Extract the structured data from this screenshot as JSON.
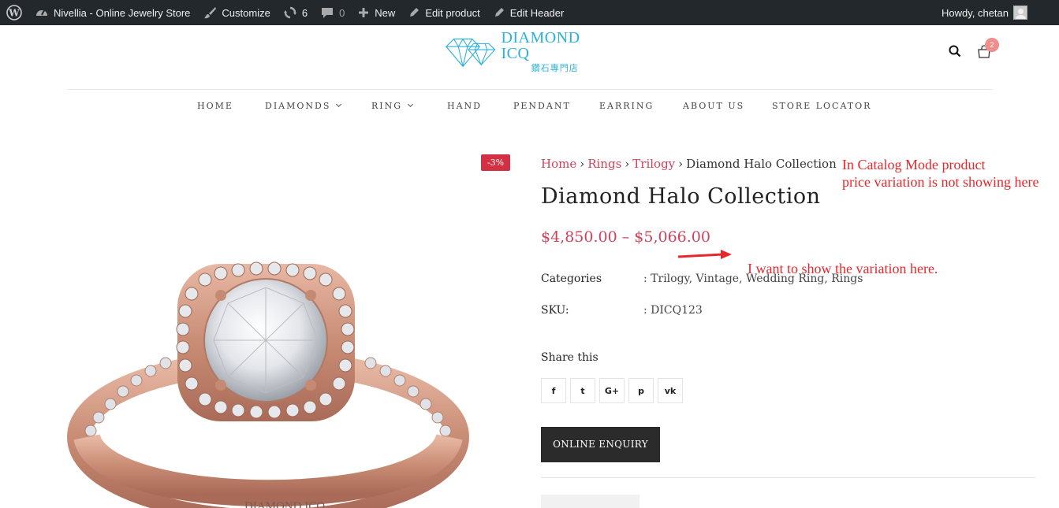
{
  "admin_bar": {
    "site_name": "Nivellia - Online Jewelry Store",
    "customize": "Customize",
    "updates_count": "6",
    "comments_count": "0",
    "new": "New",
    "edit_product": "Edit product",
    "edit_header": "Edit Header",
    "howdy": "Howdy, chetan"
  },
  "header": {
    "logo_title": "DIAMOND ICQ",
    "logo_subtitle": "鑽石專門店",
    "cart_count": "2"
  },
  "nav": {
    "items": [
      {
        "label": "HOME"
      },
      {
        "label": "DIAMONDS"
      },
      {
        "label": "RING"
      },
      {
        "label": "HAND"
      },
      {
        "label": "PENDANT"
      },
      {
        "label": "EARRING"
      },
      {
        "label": "ABOUT US"
      },
      {
        "label": "STORE LOCATOR"
      }
    ]
  },
  "product": {
    "sale_badge": "-3%",
    "breadcrumb": [
      "Home",
      "Rings",
      "Trilogy",
      "Diamond Halo Collection"
    ],
    "title": "Diamond Halo Collection",
    "price": "$4,850.00 – $5,066.00",
    "categories_label": "Categories",
    "categories_value": ": Trilogy, Vintage, Wedding Ring, Rings",
    "sku_label": "SKU:",
    "sku_value": ": DICQ123",
    "share_title": "Share this",
    "share_icons": [
      "facebook-icon",
      "twitter-icon",
      "google-plus-icon",
      "pinterest-icon",
      "vk-icon"
    ],
    "share_glyphs": [
      "f",
      "t",
      "G+",
      "p",
      "vk"
    ],
    "enquiry_button": "ONLINE ENQUIRY",
    "image_watermark": "DIAMOND ICQ"
  },
  "annotations": {
    "note_line1": "In Catalog Mode product",
    "note_line2": "price variation is not showing here",
    "note_arrow": "I want to show the variation here."
  },
  "colors": {
    "admin_bar_bg": "#23282d",
    "accent": "#d1415b",
    "logo_blue": "#2bb1d8",
    "annotation_red": "#e8272b",
    "button_dark": "#2b2b2b"
  }
}
